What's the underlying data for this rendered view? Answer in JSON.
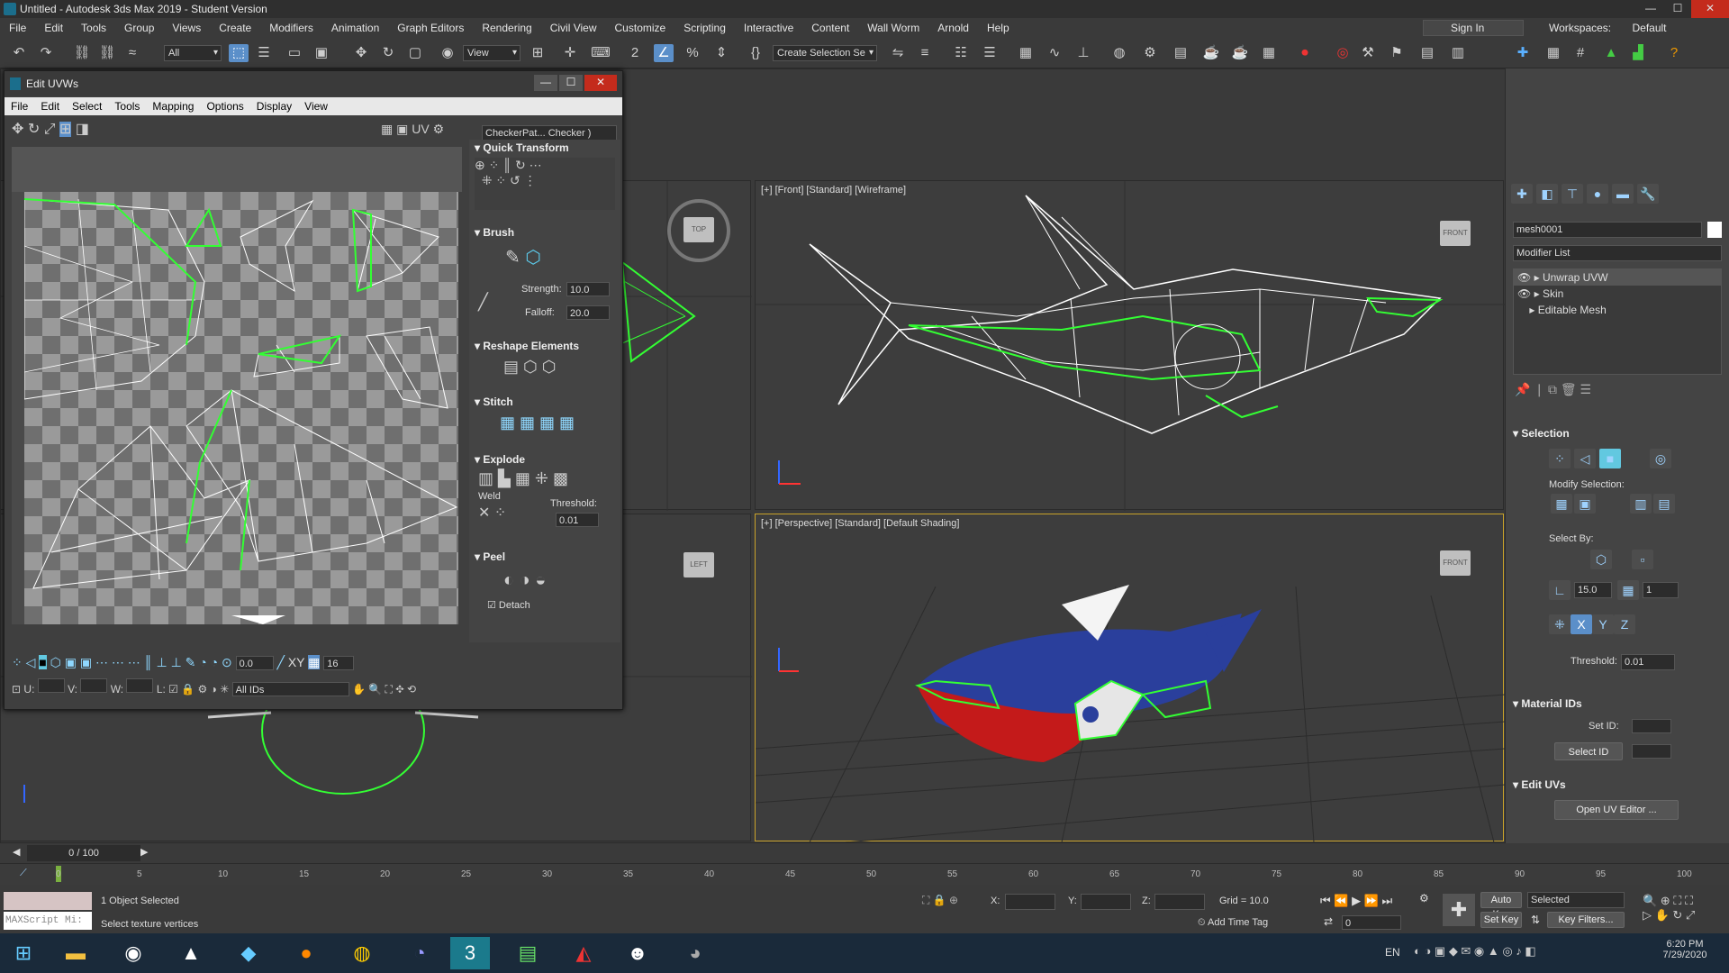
{
  "window": {
    "title": "Untitled - Autodesk 3ds Max 2019 - Student Version"
  },
  "menu": [
    "File",
    "Edit",
    "Tools",
    "Group",
    "Views",
    "Create",
    "Modifiers",
    "Animation",
    "Graph Editors",
    "Rendering",
    "Civil View",
    "Customize",
    "Scripting",
    "Interactive",
    "Content",
    "Wall Worm",
    "Arnold",
    "Help"
  ],
  "signin": "Sign In",
  "workspaces_label": "Workspaces:",
  "workspace": "Default",
  "toolbar": {
    "filter": "All",
    "view": "View",
    "selection_set": "Create Selection Se"
  },
  "uv": {
    "title": "Edit UVWs",
    "menu": [
      "File",
      "Edit",
      "Select",
      "Tools",
      "Mapping",
      "Options",
      "Display",
      "View"
    ],
    "uv_label": "UV",
    "checker": "CheckerPat... Checker )",
    "quick_transform": "Quick Transform",
    "brush": "Brush",
    "strength_label": "Strength:",
    "strength": "10.0",
    "falloff_label": "Falloff:",
    "falloff": "20.0",
    "reshape": "Reshape Elements",
    "stitch": "Stitch",
    "explode": "Explode",
    "weld": "Weld",
    "threshold_label": "Threshold:",
    "threshold": "0.01",
    "peel": "Peel",
    "detach": "Detach",
    "angle": "0.0",
    "xy": "XY",
    "grid_val": "16",
    "u": "U:",
    "v": "V:",
    "w": "W:",
    "l": "L:",
    "ids": "All IDs"
  },
  "viewports": {
    "front": "[+] [Front] [Standard] [Wireframe]",
    "perspective": "[+] [Perspective] [Standard] [Default Shading]"
  },
  "cmd": {
    "object": "mesh0001",
    "modifier_list": "Modifier List",
    "stack": [
      "Unwrap UVW",
      "Skin",
      "Editable Mesh"
    ],
    "selection": "Selection",
    "modify_selection": "Modify Selection:",
    "select_by": "Select By:",
    "angle": "15.0",
    "count": "1",
    "threshold_label": "Threshold:",
    "threshold": "0.01",
    "material_ids": "Material IDs",
    "set_id": "Set ID:",
    "select_id": "Select ID",
    "edit_uvs": "Edit UVs",
    "open_uv": "Open UV Editor ..."
  },
  "timeline": {
    "frame": "0 / 100",
    "ticks": [
      "0",
      "5",
      "10",
      "15",
      "20",
      "25",
      "30",
      "35",
      "40",
      "45",
      "50",
      "55",
      "60",
      "65",
      "70",
      "75",
      "80",
      "85",
      "90",
      "95",
      "100"
    ]
  },
  "status": {
    "maxscript": "MAXScript Mi:",
    "selected": "1 Object Selected",
    "prompt": "Select texture vertices",
    "x": "X:",
    "y": "Y:",
    "z": "Z:",
    "grid": "Grid = 10.0",
    "add_time_tag": "Add Time Tag",
    "auto_key": "Auto Key",
    "set_key": "Set Key",
    "key_mode": "Selected",
    "key_filters": "Key Filters...",
    "frame": "0"
  },
  "tray": {
    "lang": "EN",
    "time": "6:20 PM",
    "date": "7/29/2020"
  }
}
